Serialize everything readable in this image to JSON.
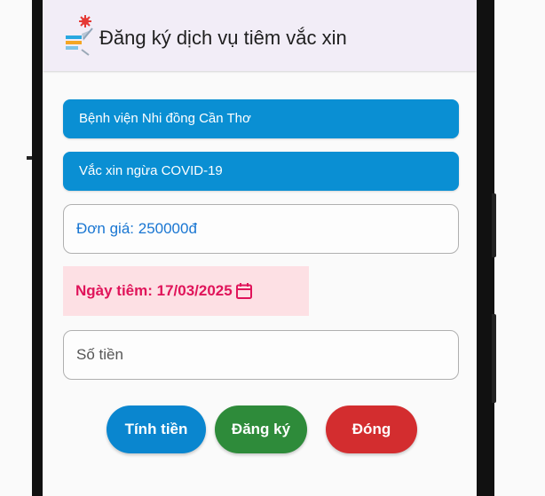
{
  "appbar": {
    "title": "Đăng ký dịch vụ tiêm vắc xin",
    "icon": "vaccine-syringe-icon"
  },
  "form": {
    "hospital_select": "Bệnh viện Nhi đồng Cần Thơ",
    "vaccine_select": "Vắc xin ngừa COVID-19",
    "price_text": "Đơn giá: 250000đ",
    "date_text": "Ngày tiêm: 17/03/2025",
    "date_icon": "calendar-icon",
    "amount_placeholder": "Số tiền"
  },
  "buttons": {
    "calculate": "Tính tiền",
    "register": "Đăng ký",
    "close": "Đóng"
  },
  "colors": {
    "appbar_bg": "#f2edf7",
    "select_bg": "#0a8fd3",
    "price_text": "#1976d2",
    "date_bg": "#fde0e4",
    "date_text": "#e0145a",
    "calculate_btn": "#0a86cf",
    "register_btn": "#2e8b3a",
    "close_btn": "#d32d2f"
  }
}
